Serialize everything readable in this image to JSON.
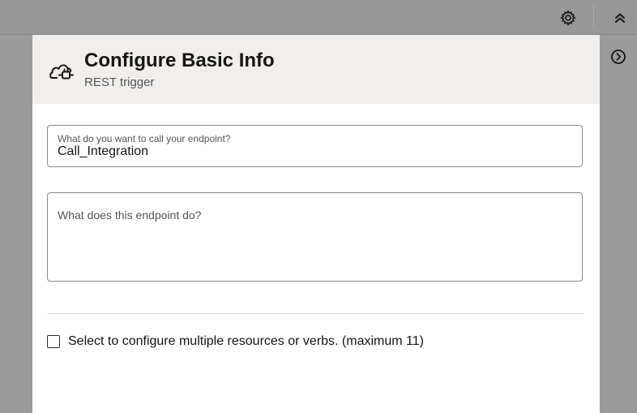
{
  "topbar": {
    "settings_icon": "gear-icon",
    "collapse_icon": "double-chevron-up-icon"
  },
  "right_rail": {
    "expand_icon": "circle-chevron-right-icon"
  },
  "panel": {
    "header": {
      "icon": "cloud-plug-icon",
      "title": "Configure Basic Info",
      "subtitle": "REST trigger"
    },
    "fields": {
      "endpoint_name": {
        "label": "What do you want to call your endpoint?",
        "value": "Call_Integration"
      },
      "endpoint_description": {
        "placeholder": "What does this endpoint do?",
        "value": ""
      }
    },
    "multiple_resources": {
      "label": "Select to configure multiple resources or verbs. (maximum 11)",
      "checked": false
    }
  },
  "colors": {
    "backdrop": "#979797",
    "header_bg": "#f1efed",
    "panel_bg": "#ffffff",
    "text": "#161513"
  }
}
